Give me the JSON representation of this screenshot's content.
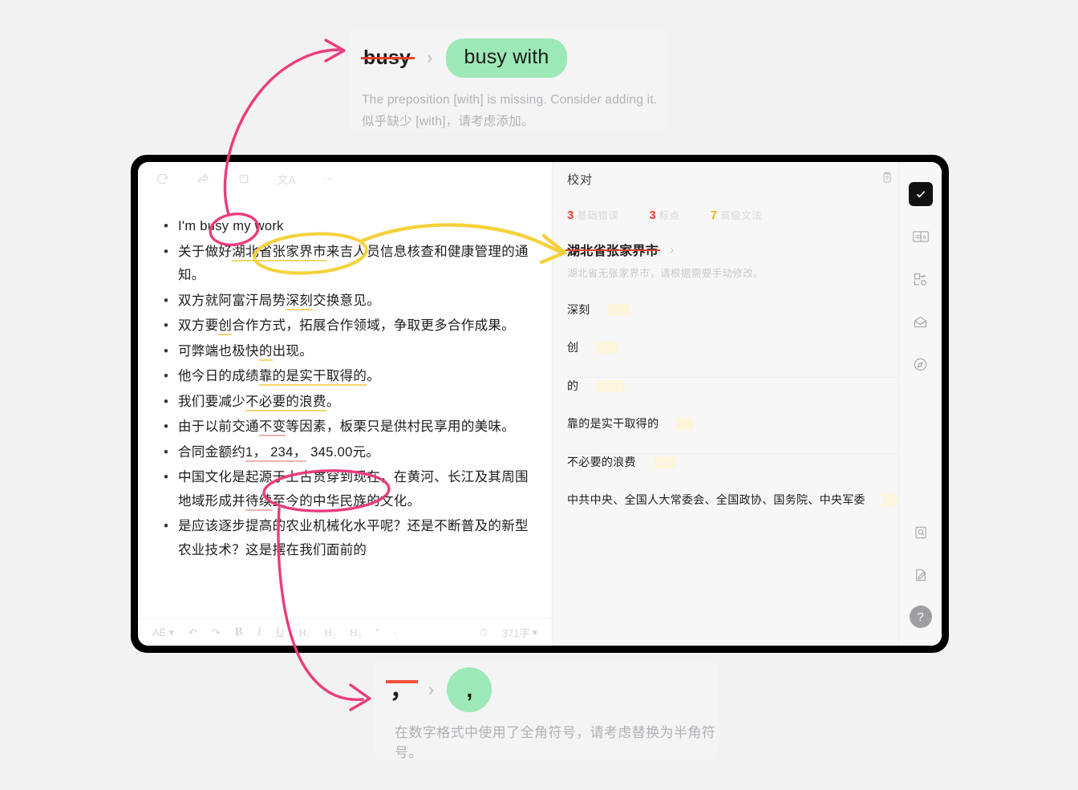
{
  "colors": {
    "page_bg": "#f2f2f2",
    "accent_green": "#9ce8b6",
    "strike_red": "#e8402a",
    "mark_pink": "#ea3c7d",
    "mark_yellow": "#f5d13c",
    "frame_black": "#000000"
  },
  "top_suggestion": {
    "original": "busy",
    "arrow": "›",
    "replacement": "busy with",
    "desc_en": "The preposition [with] is missing. Consider adding it.",
    "desc_zh": "似乎缺少 [with]，请考虑添加。"
  },
  "bottom_suggestion": {
    "original": "，",
    "arrow": "›",
    "replacement": ",",
    "desc_zh": "在数字格式中使用了全角符号，请考虑替换为半角符号。"
  },
  "editor": {
    "toolbar_top": [
      {
        "name": "refresh-icon",
        "label": "↺"
      },
      {
        "name": "share-icon",
        "label": "↪"
      },
      {
        "name": "copy-document-icon",
        "label": "❐"
      },
      {
        "name": "translate-icon",
        "label": "文A"
      },
      {
        "name": "more-options-icon",
        "label": "⋯"
      }
    ],
    "lines": [
      {
        "id": 1,
        "segments": [
          {
            "t": "I'm busy my work",
            "mark": "none"
          }
        ]
      },
      {
        "id": 2,
        "segments": [
          {
            "t": "关于做好",
            "mark": "none"
          },
          {
            "t": "湖北省张家界市",
            "mark": "yellow"
          },
          {
            "t": "来吉人员信息核查和健康管理的通知。",
            "mark": "none"
          }
        ]
      },
      {
        "id": 3,
        "segments": [
          {
            "t": "双方就阿富汗局势",
            "mark": "none"
          },
          {
            "t": "深刻",
            "mark": "yellow"
          },
          {
            "t": "交换意见。",
            "mark": "none"
          }
        ]
      },
      {
        "id": 4,
        "segments": [
          {
            "t": "双方要",
            "mark": "none"
          },
          {
            "t": "创",
            "mark": "yellow"
          },
          {
            "t": "合作方式，拓展合作领域，争取更多合作成果。",
            "mark": "none"
          }
        ]
      },
      {
        "id": 5,
        "segments": [
          {
            "t": "可弊端也极快",
            "mark": "none"
          },
          {
            "t": "的",
            "mark": "yellow"
          },
          {
            "t": "出现。",
            "mark": "none"
          }
        ]
      },
      {
        "id": 6,
        "segments": [
          {
            "t": "他今日的成绩",
            "mark": "none"
          },
          {
            "t": "靠的是实干取得的",
            "mark": "yellow"
          },
          {
            "t": "。",
            "mark": "none"
          }
        ]
      },
      {
        "id": 7,
        "segments": [
          {
            "t": "我们要减少",
            "mark": "none"
          },
          {
            "t": "不必要的浪费",
            "mark": "yellow"
          },
          {
            "t": "。",
            "mark": "none"
          }
        ]
      },
      {
        "id": 8,
        "segments": [
          {
            "t": "由于以前交通",
            "mark": "none"
          },
          {
            "t": "不变",
            "mark": "red"
          },
          {
            "t": "等因素，板栗只是供村民享用的美味。",
            "mark": "none"
          }
        ]
      },
      {
        "id": 9,
        "segments": [
          {
            "t": "合同金额约",
            "mark": "none"
          },
          {
            "t": "1，",
            "mark": "red"
          },
          {
            "t": " 234，",
            "mark": "red"
          },
          {
            "t": " 345.00",
            "mark": "none"
          },
          {
            "t": "元。",
            "mark": "none"
          }
        ]
      },
      {
        "id": 10,
        "segments": [
          {
            "t": "中国文化是起源于上古贯穿到现在，在黄河、长江及其周围地域形成并",
            "mark": "none"
          },
          {
            "t": "待续",
            "mark": "red"
          },
          {
            "t": "至今的中华民族的文化。",
            "mark": "none"
          }
        ]
      },
      {
        "id": 11,
        "segments": [
          {
            "t": "是应该逐步提高的农业机械化水平呢？还是不断普及的新型农业技术？这是摆在我们面前的",
            "mark": "none"
          }
        ]
      }
    ],
    "toolbar_bottom": {
      "font_label": "AÉ",
      "undo_label": "↶",
      "redo_label": "↷",
      "bold_label": "B",
      "italic_label": "I",
      "underline_label": "U",
      "h1_label": "H₁",
      "h2_label": "H₂",
      "h3_label": "H₃",
      "quote_label": "“",
      "divider_label": "·",
      "timer_label": "⏱",
      "word_count": "371字",
      "caret": "▾"
    }
  },
  "sidebar": {
    "title": "校对",
    "head_icons": [
      {
        "name": "clipboard-icon"
      },
      {
        "name": "checked-document-icon"
      }
    ],
    "stats": [
      {
        "count": "3",
        "label": "基础错误",
        "color": "#e8402a"
      },
      {
        "count": "3",
        "label": "标点",
        "color": "#e8402a"
      },
      {
        "count": "7",
        "label": "高级文法",
        "color": "#f2b01e"
      }
    ],
    "issues": [
      {
        "word": "湖北省张家界市",
        "struck": true,
        "faded": false,
        "chevron": "›",
        "desc": "湖北省无张家界市，请根据需要手动修改。",
        "ghost": ""
      },
      {
        "word": "深刻",
        "struck": false,
        "faded": false,
        "chevron": "",
        "desc": "",
        "ghost": "· · · ·"
      },
      {
        "word": "创",
        "struck": false,
        "faded": false,
        "chevron": "",
        "desc": "",
        "ghost": "· · · ·"
      },
      {
        "word": "的",
        "struck": false,
        "faded": false,
        "chevron": "",
        "desc": "",
        "ghost": "· · · · ·"
      },
      {
        "word": "靠的是实干取得的",
        "struck": false,
        "faded": false,
        "chevron": "",
        "desc": "",
        "ghost": "· · ·"
      },
      {
        "word": "不必要的浪费",
        "struck": false,
        "faded": false,
        "chevron": "",
        "desc": "",
        "ghost": "· · · ·"
      },
      {
        "word": "中共中央、全国人大常委会、全国政协、国务院、中央军委",
        "struck": false,
        "faded": false,
        "chevron": "",
        "desc": "",
        "ghost": "· · · · · ·"
      }
    ]
  },
  "rail": {
    "items": [
      {
        "name": "proofread-check-icon",
        "active": true
      },
      {
        "name": "translate-zh-a-icon",
        "active": false
      },
      {
        "name": "compare-diff-icon",
        "active": false
      },
      {
        "name": "envelope-upload-icon",
        "active": false
      },
      {
        "name": "compass-icon",
        "active": false
      }
    ],
    "bottom_items": [
      {
        "name": "search-document-icon",
        "active": false
      },
      {
        "name": "document-pen-icon",
        "active": false
      }
    ],
    "help_label": "?"
  }
}
